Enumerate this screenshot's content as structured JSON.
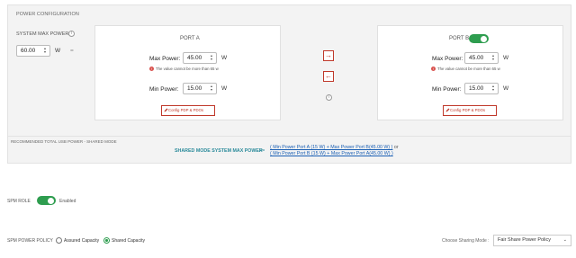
{
  "panel": {
    "title": "POWER CONFIGURATION"
  },
  "system": {
    "label": "SYSTEM MAX POWER",
    "value": "60.00",
    "unit": "W",
    "equals": "="
  },
  "portA": {
    "title": "PORT A",
    "max_label": "Max Power:",
    "max_value": "45.00",
    "max_unit": "W",
    "warning": "The value cannot be more than 65 w",
    "min_label": "Min Power:",
    "min_value": "15.00",
    "min_unit": "W",
    "config_button": "Config PDP & PDOs"
  },
  "portB": {
    "title": "PORT B",
    "enabled": true,
    "max_label": "Max Power:",
    "max_value": "45.00",
    "max_unit": "W",
    "warning": "The value cannot be more than 65 w",
    "min_label": "Min Power:",
    "min_value": "15.00",
    "min_unit": "W",
    "config_button": "Config PDP & PDOs"
  },
  "arrows": {
    "right_icon": "arrow-right-icon",
    "left_icon": "arrow-left-icon"
  },
  "recommended": {
    "title": "RECOMMENDED TOTAL USB POWER - SHARED MODE",
    "shared_label": "SHARED MODE SYSTEM MAX POWER",
    "arrow": ">=",
    "line1": "( Min Power Port A (15 W) + Max Power Port B(45.00 W) )",
    "or": "or",
    "line2": "( Min Power Port B (15 W) + Max Power Port A(45.00 W) )"
  },
  "spm_role": {
    "label": "SPM ROLE",
    "state": "Enabled",
    "enabled": true
  },
  "policy": {
    "label": "SPM POWER POLICY",
    "options": [
      "Assured Capacity",
      "Shared Capacity"
    ],
    "selected": "Shared Capacity"
  },
  "sharing": {
    "label": "Choose Sharing Mode :",
    "value": "Fair Share Power Policy"
  },
  "colors": {
    "accent_green": "#2e9d4f",
    "button_red": "#c0392b",
    "link_blue": "#1a5fb4",
    "teal": "#2a8a9a"
  }
}
